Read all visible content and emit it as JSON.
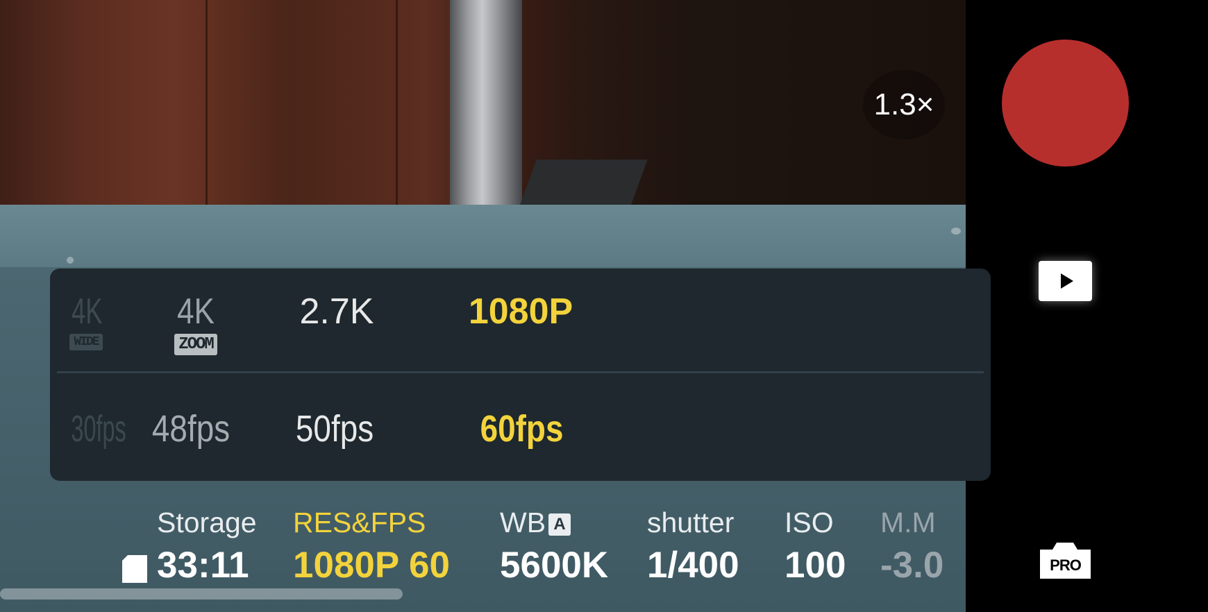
{
  "zoom": {
    "label": "1.3×"
  },
  "resolution_options": [
    {
      "label": "4K",
      "badge": "WIDE"
    },
    {
      "label": "4K",
      "badge": "ZOOM"
    },
    {
      "label": "2.7K",
      "badge": ""
    },
    {
      "label": "1080P",
      "badge": ""
    }
  ],
  "fps_options": [
    {
      "label": "30fps"
    },
    {
      "label": "48fps"
    },
    {
      "label": "50fps"
    },
    {
      "label": "60fps"
    }
  ],
  "selected": {
    "resolution": "1080P",
    "fps": "60fps"
  },
  "info_bar": {
    "storage": {
      "label": "Storage",
      "value": "33:11"
    },
    "res_fps": {
      "label": "RES&FPS",
      "value": "1080P 60"
    },
    "wb": {
      "label": "WB",
      "badge": "A",
      "value": "5600K"
    },
    "shutter": {
      "label": "shutter",
      "value": "1/400"
    },
    "iso": {
      "label": "ISO",
      "value": "100"
    },
    "mm": {
      "label": "M.M",
      "value": "-3.0"
    }
  },
  "rail": {
    "pro_label": "PRO"
  },
  "colors": {
    "accent": "#f3d33c",
    "record": "#b72f2d",
    "panel": "#1e282e"
  },
  "icons": [
    "play-icon",
    "pro-camera-icon",
    "sd-card-icon"
  ]
}
